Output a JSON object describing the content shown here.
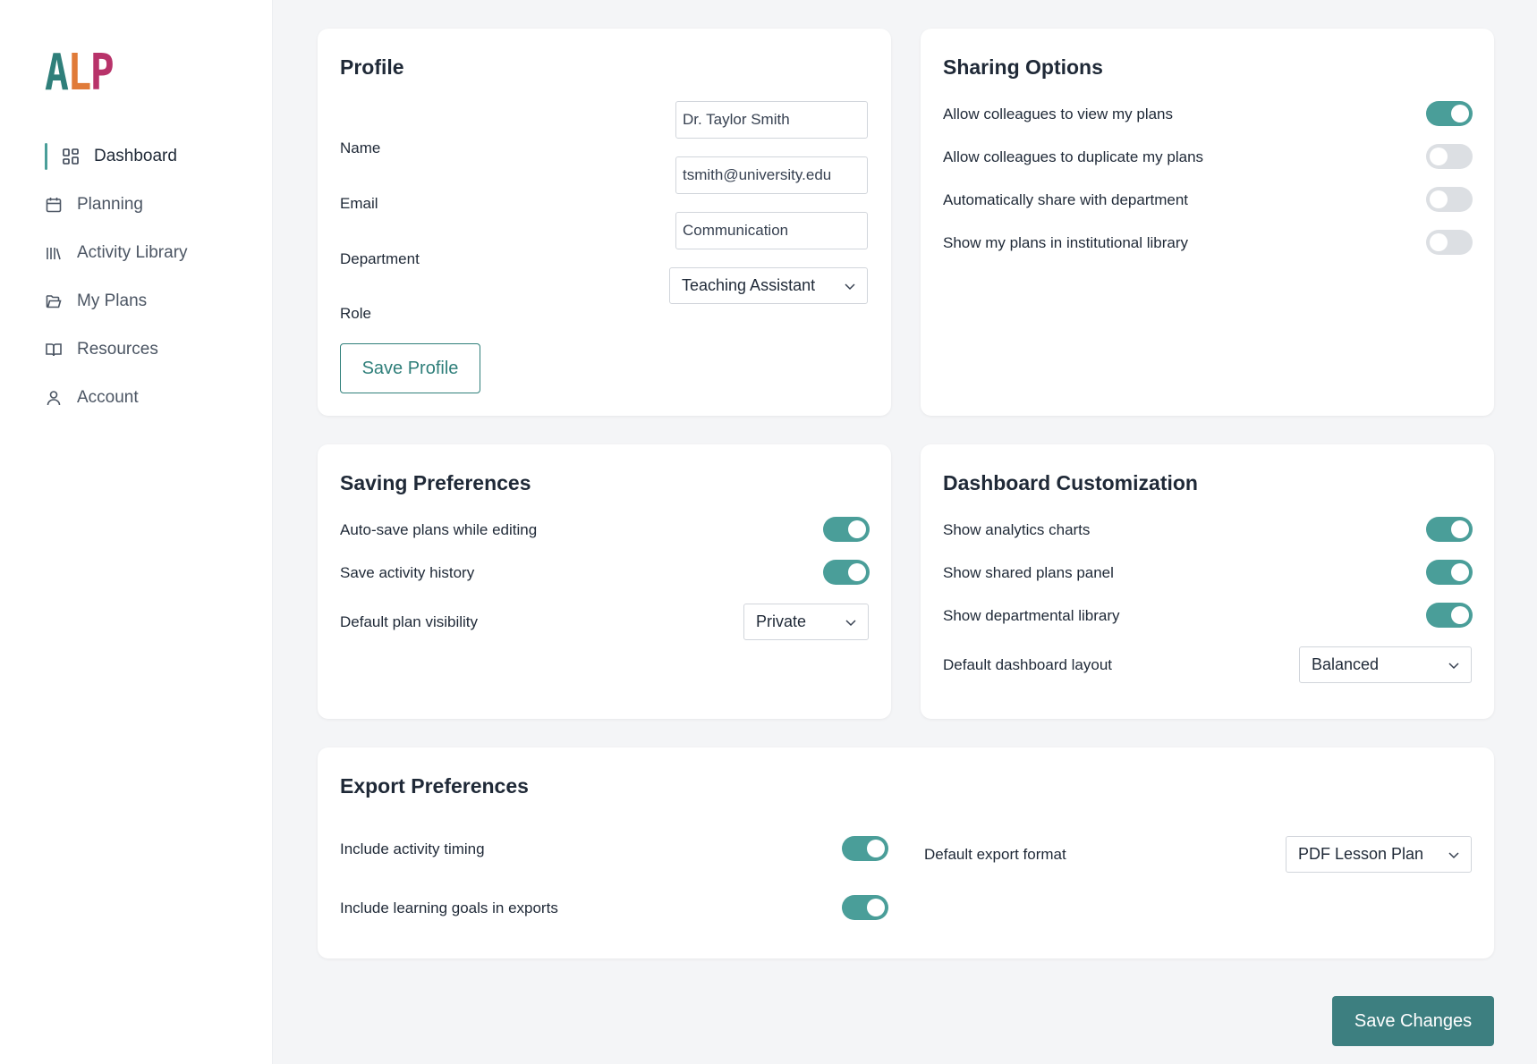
{
  "logo": {
    "parts": [
      "A",
      "L",
      "P"
    ]
  },
  "colors": {
    "accent": "#4a9e99",
    "primary_button": "#3d7f80",
    "toggle_off": "#dcdfe3",
    "logo_a": "#2f7f7a",
    "logo_l": "#e07b39",
    "logo_p": "#b8336a"
  },
  "sidebar": {
    "items": [
      {
        "label": "Dashboard",
        "icon": "grid-icon",
        "active": true
      },
      {
        "label": "Planning",
        "icon": "calendar-icon"
      },
      {
        "label": "Activity Library",
        "icon": "library-icon"
      },
      {
        "label": "My Plans",
        "icon": "folder-icon"
      },
      {
        "label": "Resources",
        "icon": "book-icon"
      },
      {
        "label": "Account",
        "icon": "user-icon"
      }
    ]
  },
  "profile": {
    "title": "Profile",
    "name_label": "Name",
    "name_value": "Dr. Taylor Smith",
    "email_label": "Email",
    "email_value": "tsmith@university.edu",
    "department_label": "Department",
    "department_value": "Communication",
    "role_label": "Role",
    "role_value": "Teaching Assistant",
    "save_label": "Save Profile"
  },
  "sharing": {
    "title": "Sharing Options",
    "options": [
      {
        "label": "Allow colleagues to view my plans",
        "on": true
      },
      {
        "label": "Allow colleagues to duplicate my plans",
        "on": false
      },
      {
        "label": "Automatically share with department",
        "on": false
      },
      {
        "label": "Show my plans in institutional library",
        "on": false
      }
    ]
  },
  "saving": {
    "title": "Saving Preferences",
    "options": [
      {
        "label": "Auto-save plans while editing",
        "on": true
      },
      {
        "label": "Save activity history",
        "on": true
      }
    ],
    "visibility_label": "Default plan visibility",
    "visibility_value": "Private"
  },
  "dashboard": {
    "title": "Dashboard Customization",
    "options": [
      {
        "label": "Show analytics charts",
        "on": true
      },
      {
        "label": "Show shared plans panel",
        "on": true
      },
      {
        "label": "Show departmental library",
        "on": true
      }
    ],
    "layout_label": "Default dashboard layout",
    "layout_value": "Balanced"
  },
  "export": {
    "title": "Export Preferences",
    "options": [
      {
        "label": "Include activity timing",
        "on": true
      },
      {
        "label": "Include learning goals in exports",
        "on": true
      }
    ],
    "format_label": "Default export format",
    "format_value": "PDF Lesson Plan"
  },
  "save_changes_label": "Save Changes"
}
